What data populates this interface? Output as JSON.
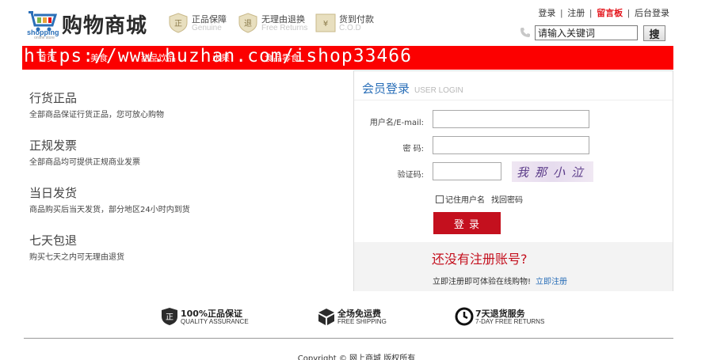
{
  "header": {
    "logo_small": "shopping",
    "logo_tiny": "online store",
    "logo_text": "购物商城",
    "guarantees": [
      {
        "title": "正品保障",
        "sub": "Genuine",
        "icon": "genuine-badge-icon"
      },
      {
        "title": "无理由退换",
        "sub": "Free Returns",
        "icon": "return-badge-icon"
      },
      {
        "title": "货到付款",
        "sub": "C.O.D",
        "icon": "cod-badge-icon"
      }
    ],
    "links": {
      "login": "登录",
      "register": "注册",
      "guestbook": "留言板",
      "admin": "后台登录",
      "separator": "|"
    },
    "search": {
      "value": "请输入关键词",
      "button": "搜"
    }
  },
  "nav": {
    "items": [
      "首页",
      "美食",
      "甜品饮品",
      "水果",
      "食品零食"
    ],
    "watermark": "https://www.huzhan.com/ishop33466"
  },
  "features": [
    {
      "title": "行货正品",
      "desc": "全部商品保证行货正品，您可放心购物"
    },
    {
      "title": "正规发票",
      "desc": "全部商品均可提供正规商业发票"
    },
    {
      "title": "当日发货",
      "desc": "商品购买后当天发货，部分地区24小时内到货"
    },
    {
      "title": "七天包退",
      "desc": "购买七天之内可无理由退货"
    }
  ],
  "login": {
    "title": "会员登录",
    "title_en": "USER LOGIN",
    "username_label": "用户名/E-mail:",
    "password_label": "密  码:",
    "captcha_label": "验证码:",
    "captcha_text": "我那小泣",
    "remember": "记住用户名",
    "forgot": "找回密码",
    "submit": "登 录",
    "no_account": "还没有注册账号?",
    "register_hint": "立即注册即可体验在线购物!",
    "register_link": "立即注册"
  },
  "services": [
    {
      "title": "100%正品保证",
      "sub": "QUALITY ASSURANCE",
      "icon": "quality-shield-icon"
    },
    {
      "title": "全场免运费",
      "sub": "FREE SHIPPING",
      "icon": "package-box-icon"
    },
    {
      "title": "7天退货服务",
      "sub": "7-DAY FREE RETURNS",
      "icon": "clock-icon"
    }
  ],
  "footer": {
    "copyright": "Copyright © 网上商城 版权所有"
  },
  "colors": {
    "nav_red": "#fc0000",
    "brand_blue": "#2a6fb8",
    "login_button": "#c4101e"
  }
}
